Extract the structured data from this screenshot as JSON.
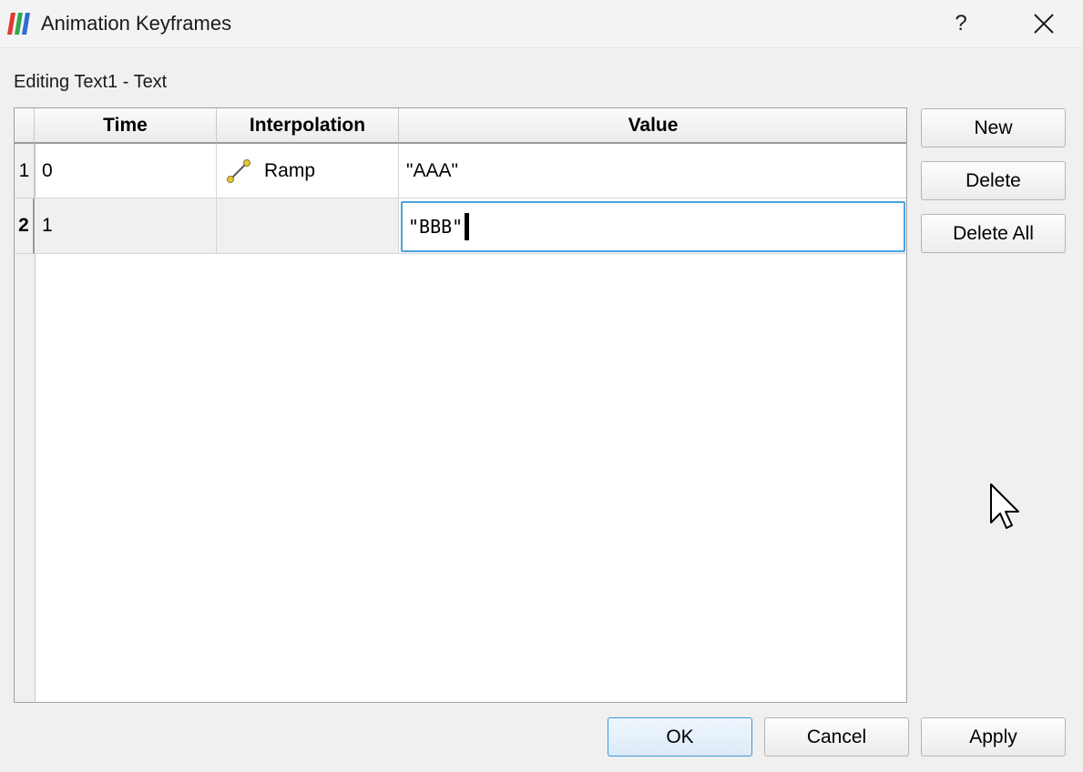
{
  "window": {
    "title": "Animation Keyframes",
    "help_label": "?",
    "app_icon": "paraview-icon",
    "close_icon": "close-icon"
  },
  "subtitle": "Editing Text1 - Text",
  "table": {
    "columns": [
      "Time",
      "Interpolation",
      "Value"
    ],
    "rows": [
      {
        "number": "1",
        "time": "0",
        "interpolation": "Ramp",
        "interpolation_icon": "ramp-icon",
        "value": "\"AAA\""
      },
      {
        "number": "2",
        "time": "1",
        "interpolation": "",
        "value": "\"BBB\"",
        "editing": true
      }
    ]
  },
  "side_buttons": {
    "new": "New",
    "delete": "Delete",
    "delete_all": "Delete All"
  },
  "footer_buttons": {
    "ok": "OK",
    "cancel": "Cancel",
    "apply": "Apply"
  },
  "colors": {
    "focus_border": "#4aa3df",
    "default_button_border": "#3b95d8"
  }
}
